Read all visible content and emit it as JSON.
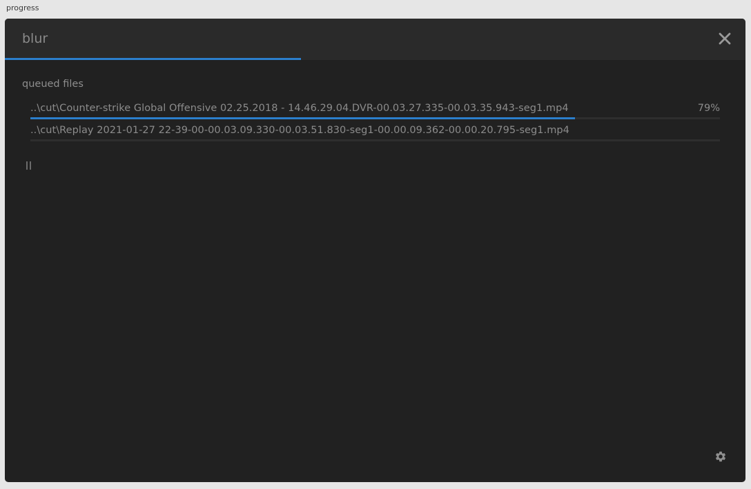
{
  "window": {
    "outer_title": "progress",
    "title": "blur"
  },
  "header": {
    "overall_progress": 0.4,
    "close_icon": "close-icon"
  },
  "queue": {
    "label": "queued files",
    "files": [
      {
        "name": "..\\cut\\Counter-strike  Global Offensive 02.25.2018 - 14.46.29.04.DVR-00.03.27.335-00.03.35.943-seg1.mp4",
        "percent": "79%",
        "progress": 0.79
      },
      {
        "name": "..\\cut\\Replay 2021-01-27 22-39-00-00.03.09.330-00.03.51.830-seg1-00.00.09.362-00.00.20.795-seg1.mp4",
        "percent": "",
        "progress": 0
      }
    ]
  },
  "controls": {
    "pause_icon": "pause-icon",
    "settings_icon": "gear-icon"
  },
  "colors": {
    "accent": "#2b7fcc",
    "background": "#212121",
    "header_bg": "#2a2a2a",
    "text": "#8c8c8c"
  }
}
